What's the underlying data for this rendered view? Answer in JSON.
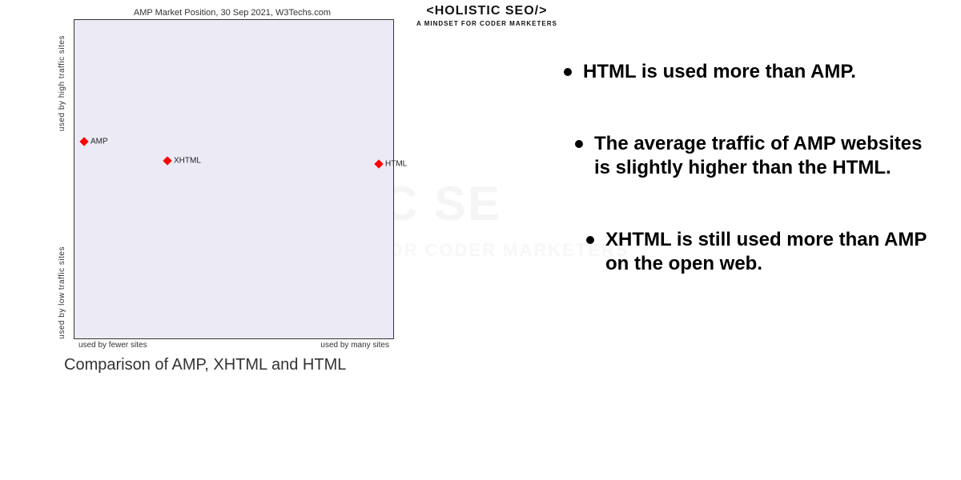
{
  "brand": {
    "name": "<HOLISTIC SEO/>",
    "tagline": "A MINDSET FOR CODER MARKETERS"
  },
  "watermark": {
    "big": "ISTIC SE",
    "small": "FOR CODER MARKETERS"
  },
  "chart_data": {
    "type": "scatter",
    "title": "AMP Market Position, 30 Sep 2021, W3Techs.com",
    "xlabel_left": "used by fewer sites",
    "xlabel_right": "used by many sites",
    "ylabel_top": "used by high traffic sites",
    "ylabel_bot": "used by low traffic sites",
    "xlim": [
      0,
      100
    ],
    "ylim": [
      0,
      100
    ],
    "series": [
      {
        "name": "AMP",
        "x": 3,
        "y": 62
      },
      {
        "name": "XHTML",
        "x": 29,
        "y": 56
      },
      {
        "name": "HTML",
        "x": 95,
        "y": 55
      }
    ]
  },
  "caption": "Comparison of AMP, XHTML and HTML",
  "bullets": [
    "HTML is used more than AMP.",
    "The average traffic of AMP websites is slightly higher than the HTML.",
    "XHTML is still used more than AMP on the open web."
  ]
}
